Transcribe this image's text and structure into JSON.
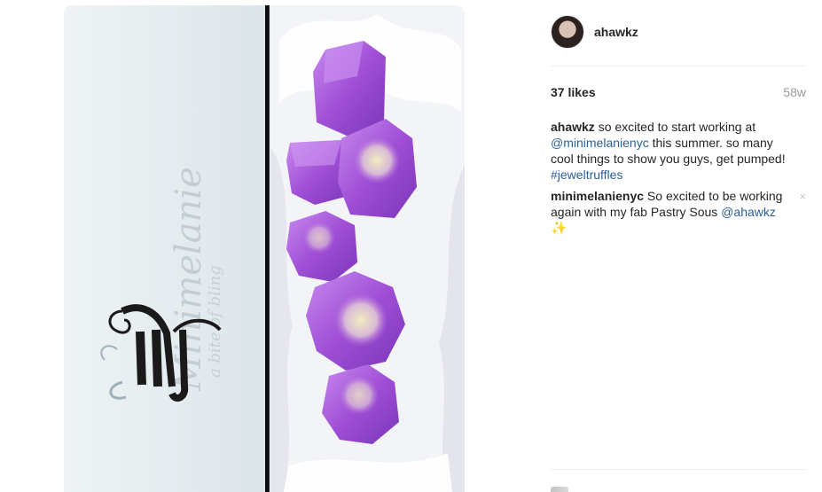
{
  "post": {
    "author": {
      "username": "ahawkz"
    },
    "likes_label": "37 likes",
    "timestamp": "58w",
    "caption": {
      "username": "ahawkz",
      "text_1": " so excited to start working at ",
      "mention": "@minimelanienyc",
      "text_2": " this summer. so many cool things to show you guys, get pumped! ",
      "hashtag": "#jeweltruffles"
    },
    "comments": [
      {
        "username": "minimelanienyc",
        "text": " So excited to be working again with my fab Pastry Sous ",
        "mention": "@ahawkz",
        "emoji": "✨",
        "delete_icon": "×"
      }
    ]
  },
  "photo": {
    "lid_text": "Minimelanie",
    "lid_tagline": "a bite of bling",
    "truffle_colors": [
      "#8b3fc9",
      "#a452d8",
      "#c488ea"
    ],
    "accent_colors": {
      "link": "#2b5f9a",
      "muted": "#999999"
    }
  }
}
